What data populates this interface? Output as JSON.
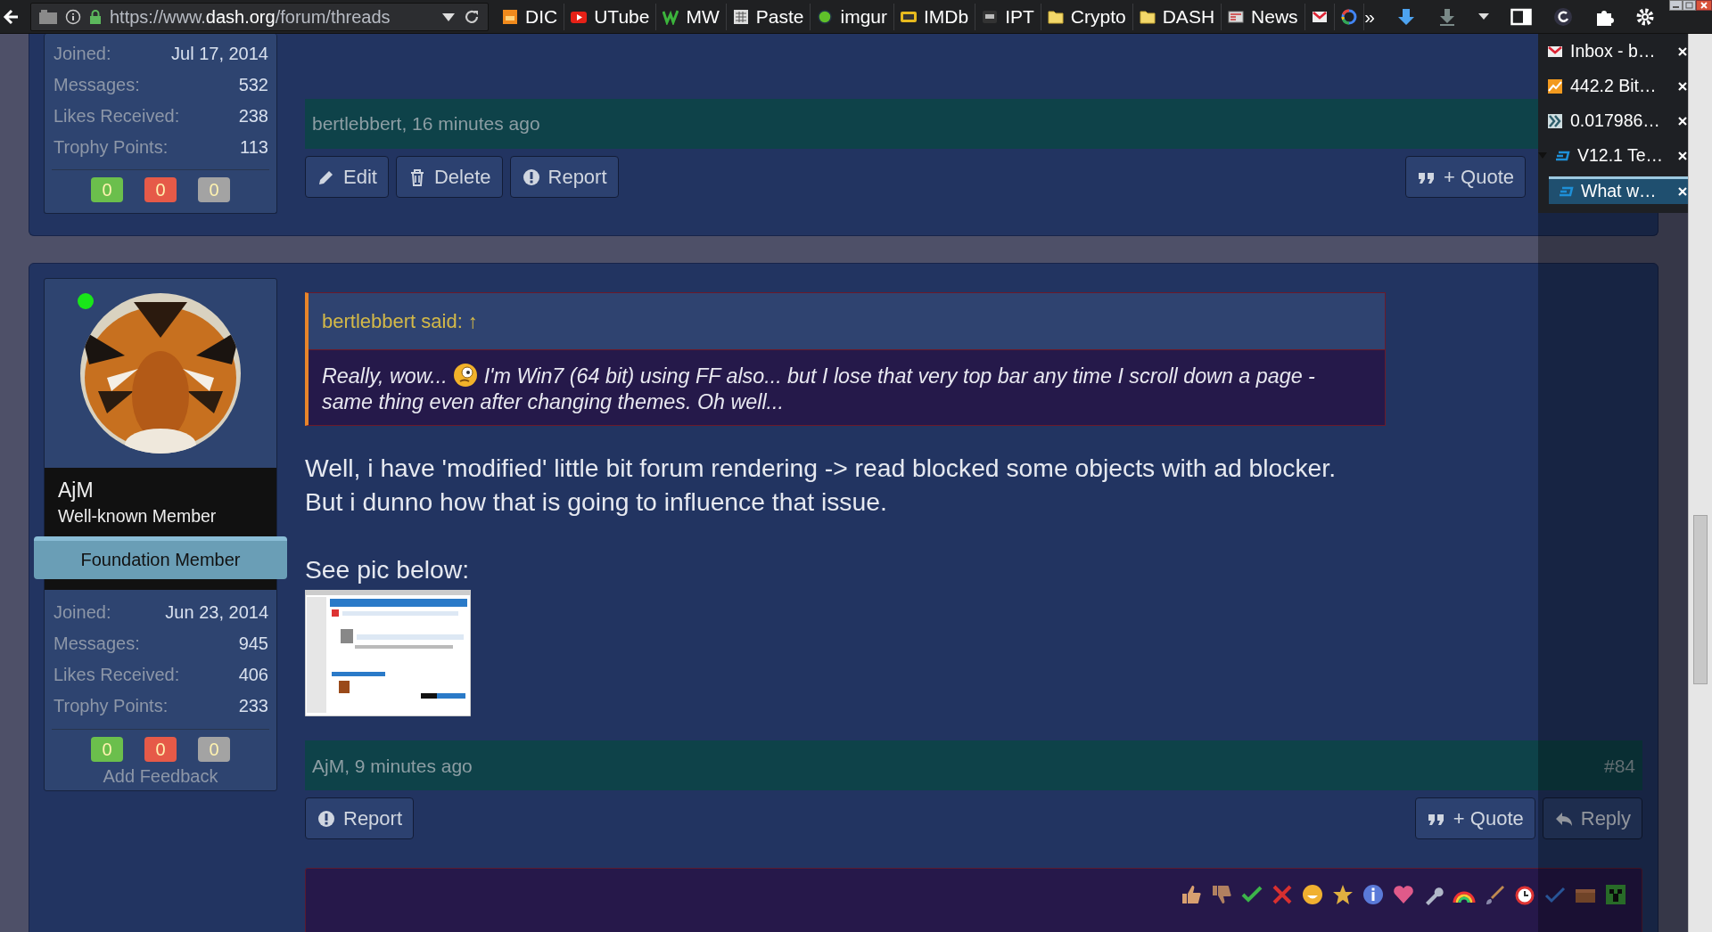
{
  "browser": {
    "url": "https://www.**dash.org**/forum/threads",
    "overflow": "»",
    "bookmarks": [
      {
        "kind": "ud",
        "label": "DIC"
      },
      {
        "kind": "youtube",
        "label": "UTube"
      },
      {
        "kind": "w",
        "label": "MW"
      },
      {
        "kind": "paste",
        "label": "Paste"
      },
      {
        "kind": "dot",
        "label": "imgur"
      },
      {
        "kind": "imdb",
        "label": "IMDb"
      },
      {
        "kind": "ipt",
        "label": "IPT"
      },
      {
        "kind": "folder",
        "label": "Crypto"
      },
      {
        "kind": "folder",
        "label": "DASH"
      },
      {
        "kind": "news",
        "label": "News"
      },
      {
        "kind": "gmail"
      },
      {
        "kind": "google"
      }
    ]
  },
  "tab_tree": [
    {
      "kind": "gmail",
      "title": "Inbox - b…",
      "selected": false
    },
    {
      "kind": "chart",
      "title": "442.2 Bit…",
      "selected": false
    },
    {
      "kind": "exchange",
      "title": "0.017986…",
      "selected": false
    },
    {
      "kind": "dash",
      "title": "V12.1 Te…",
      "selected": false,
      "expanded": true,
      "children": [
        {
          "kind": "dash",
          "title": "What w…",
          "selected": true
        }
      ]
    }
  ],
  "posts": [
    {
      "stats": [
        {
          "label": "Joined:",
          "value": "Jul 17, 2014"
        },
        {
          "label": "Messages:",
          "value": "532"
        },
        {
          "label": "Likes Received:",
          "value": "238"
        },
        {
          "label": "Trophy Points:",
          "value": "113"
        }
      ],
      "feedback": [
        {
          "kind": "positive",
          "count": "0"
        },
        {
          "kind": "negative",
          "count": "0"
        },
        {
          "kind": "neutral",
          "count": "0"
        }
      ],
      "meta": "bertlebbert, 16 minutes ago",
      "actions_left": [
        {
          "kind": "edit",
          "label": "Edit"
        },
        {
          "kind": "delete",
          "label": "Delete"
        },
        {
          "kind": "report",
          "label": "Report"
        }
      ],
      "actions_right": [
        {
          "kind": "quote",
          "label": "+ Quote"
        }
      ]
    },
    {
      "user": {
        "name": "AjM",
        "title": "Well-known Member",
        "banner": "Foundation Member",
        "online": true
      },
      "stats": [
        {
          "label": "Joined:",
          "value": "Jun 23, 2014"
        },
        {
          "label": "Messages:",
          "value": "945"
        },
        {
          "label": "Likes Received:",
          "value": "406"
        },
        {
          "label": "Trophy Points:",
          "value": "233"
        }
      ],
      "feedback": [
        {
          "kind": "positive",
          "count": "0"
        },
        {
          "kind": "negative",
          "count": "0"
        },
        {
          "kind": "neutral",
          "count": "0"
        }
      ],
      "add_feedback": "Add Feedback",
      "quote": {
        "header": "bertlebbert said: ↑",
        "text_before": "Really, wow...",
        "text_after": "I'm Win7 (64 bit) using FF also... but I lose that very top bar any time I scroll down a page -\nsame thing even after changing themes. Oh well..."
      },
      "paragraphs": [
        "Well, i have 'modified' little bit forum rendering -> read blocked some objects with ad blocker.\nBut i dunno how that is going to influence that issue.",
        "See pic below:"
      ],
      "meta": "AjM, 9 minutes ago",
      "number": "#84",
      "actions_left": [
        {
          "kind": "report",
          "label": "Report"
        }
      ],
      "actions_right": [
        {
          "kind": "quote",
          "label": "+ Quote"
        },
        {
          "kind": "reply",
          "label": "Reply"
        }
      ]
    }
  ]
}
